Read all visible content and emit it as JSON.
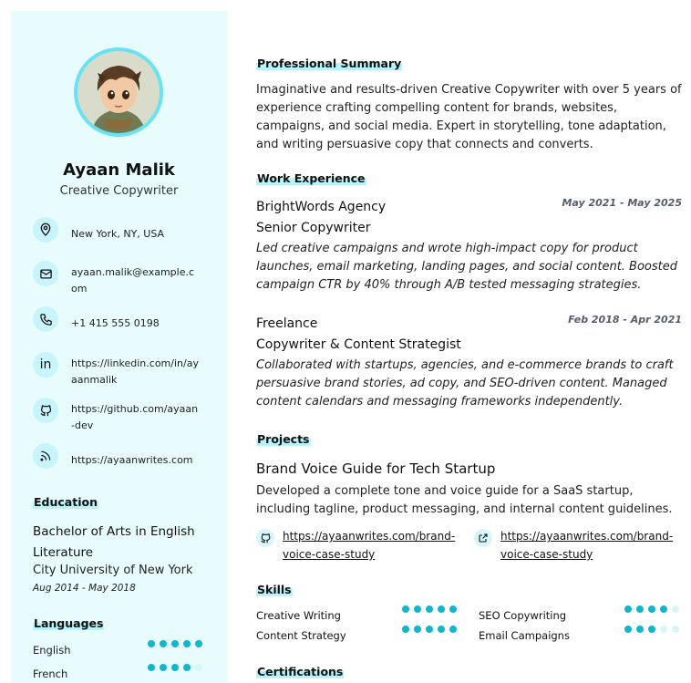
{
  "profile": {
    "name": "Ayaan Malik",
    "role": "Creative Copywriter"
  },
  "contacts": [
    {
      "icon": "location-icon",
      "text": "New York, NY, USA"
    },
    {
      "icon": "mail-icon",
      "text": "ayaan.malik@example.com"
    },
    {
      "icon": "phone-icon",
      "text": "+1 415 555 0198"
    },
    {
      "icon": "linkedin-icon",
      "text": "https://linkedin.com/in/ayaanmalik"
    },
    {
      "icon": "github-icon",
      "text": "https://github.com/ayaan-dev"
    },
    {
      "icon": "rss-icon",
      "text": "https://ayaanwrites.com"
    }
  ],
  "education": {
    "heading": "Education",
    "degree": "Bachelor of Arts in English Literature",
    "school": "City University of New York",
    "dates": "Aug 2014 - May 2018"
  },
  "languages": {
    "heading": "Languages",
    "items": [
      {
        "name": "English",
        "level": 5,
        "max": 5
      },
      {
        "name": "French",
        "level": 4,
        "max": 5
      }
    ]
  },
  "summary": {
    "heading": "Professional Summary",
    "text": "Imaginative and results-driven Creative Copywriter with over 5 years of experience crafting compelling content for brands, websites, campaigns, and social media. Expert in storytelling, tone adaptation, and writing persuasive copy that connects and converts."
  },
  "experience": {
    "heading": "Work Experience",
    "jobs": [
      {
        "company": "BrightWords Agency",
        "dates": "May 2021 - May 2025",
        "title": "Senior Copywriter",
        "description": "Led creative campaigns and wrote high-impact copy for product launches, email marketing, landing pages, and social content. Boosted campaign CTR by 40% through A/B tested messaging strategies."
      },
      {
        "company": "Freelance",
        "dates": "Feb 2018 - Apr 2021",
        "title": "Copywriter & Content Strategist",
        "description": "Collaborated with startups, agencies, and e-commerce brands to craft persuasive brand stories, ad copy, and SEO-driven content. Managed content calendars and messaging frameworks independently."
      }
    ]
  },
  "projects": {
    "heading": "Projects",
    "items": [
      {
        "title": "Brand Voice Guide for Tech Startup",
        "description": "Developed a complete tone and voice guide for a SaaS startup, including tagline, product messaging, and internal content guidelines.",
        "repo_link": "https://ayaanwrites.com/brand-voice-case-study",
        "live_link": "https://ayaanwrites.com/brand-voice-case-study"
      }
    ]
  },
  "skills": {
    "heading": "Skills",
    "items": [
      {
        "name": "Creative Writing",
        "level": 5,
        "max": 5
      },
      {
        "name": "SEO Copywriting",
        "level": 4,
        "max": 5
      },
      {
        "name": "Content Strategy",
        "level": 5,
        "max": 5
      },
      {
        "name": "Email Campaigns",
        "level": 3,
        "max": 5
      }
    ]
  },
  "certifications": {
    "heading": "Certifications"
  },
  "colors": {
    "sidebar_bg": "#e8fcfe",
    "accent": "#10b6cf",
    "highlight": "#b6f3fa"
  }
}
